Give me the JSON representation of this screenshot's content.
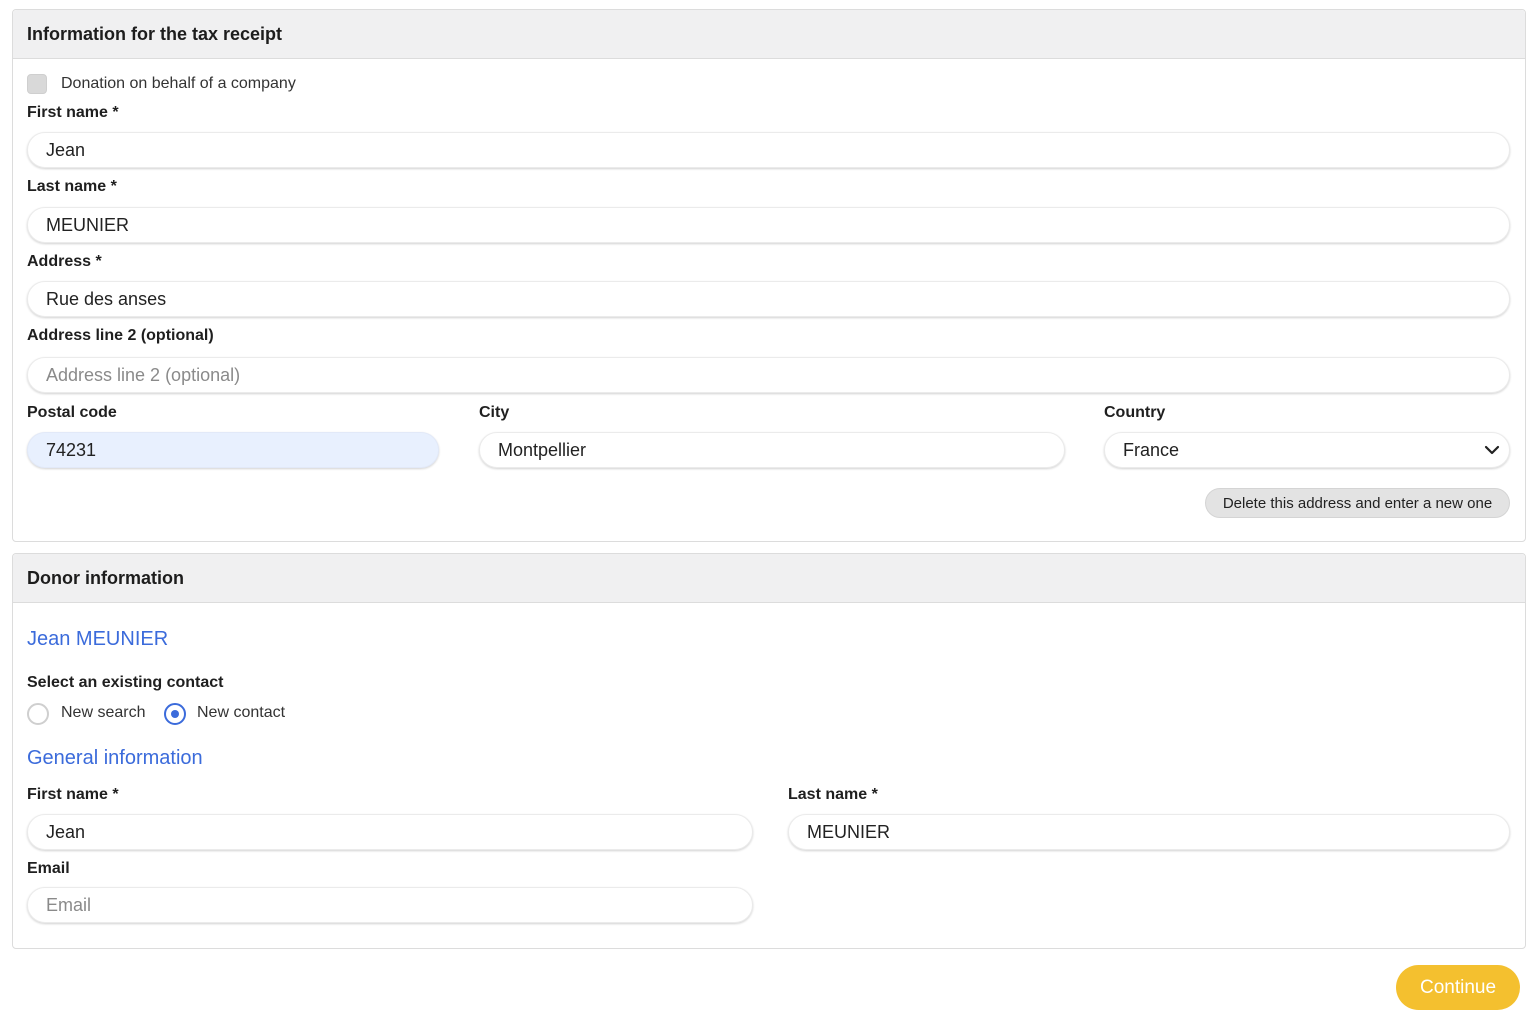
{
  "tax_receipt": {
    "header": "Information for the tax receipt",
    "company_checkbox_label": "Donation on behalf of a company",
    "first_name_label": "First name *",
    "first_name_value": "Jean",
    "last_name_label": "Last name *",
    "last_name_value": "MEUNIER",
    "address_label": "Address *",
    "address_value": "Rue des anses",
    "address2_label": "Address line 2 (optional)",
    "address2_placeholder": "Address line 2 (optional)",
    "postal_label": "Postal code",
    "postal_value": "74231",
    "city_label": "City",
    "city_value": "Montpellier",
    "country_label": "Country",
    "country_value": "France",
    "delete_address_button": "Delete this address and enter a new one"
  },
  "donor": {
    "header": "Donor information",
    "donor_name": "Jean MEUNIER",
    "select_contact_label": "Select an existing contact",
    "radio_new_search": "New search",
    "radio_new_contact": "New contact",
    "selected_radio": "New contact",
    "general_info_title": "General information",
    "first_name_label": "First name *",
    "first_name_value": "Jean",
    "last_name_label": "Last name *",
    "last_name_value": "MEUNIER",
    "email_label": "Email",
    "email_placeholder": "Email"
  },
  "footer": {
    "continue_button": "Continue"
  },
  "icons": {
    "country_dropdown": "chevron-down-icon"
  },
  "colors": {
    "accent_blue": "#3b6bdb",
    "continue_yellow": "#f4c02f",
    "autofill_bg": "#e8f0fe"
  }
}
